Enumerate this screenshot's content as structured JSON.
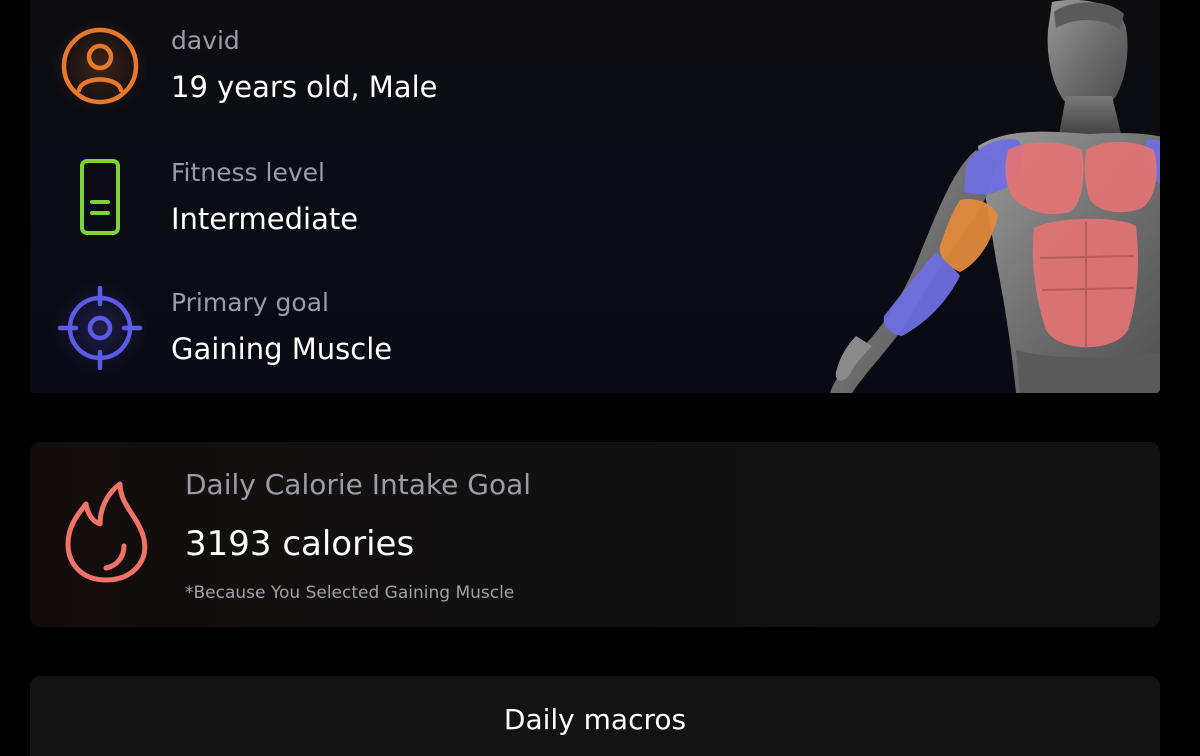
{
  "profile": {
    "user": {
      "name": "david",
      "details": "19 years old, Male",
      "icon": "user-icon",
      "color": "#E8792A"
    },
    "fitness": {
      "label": "Fitness level",
      "value": "Intermediate",
      "icon": "clipboard-icon",
      "color": "#7ED33A"
    },
    "goal": {
      "label": "Primary goal",
      "value": "Gaining Muscle",
      "icon": "target-icon",
      "color": "#5B5BE6"
    },
    "figure": {
      "icon": "muscle-body-figure",
      "highlight_colors": {
        "chest_abs": "#E57373",
        "shoulders_biceps": "#6F6FE0",
        "forearms": "#E08A3C"
      }
    }
  },
  "calorie": {
    "label": "Daily Calorie Intake Goal",
    "value": "3193 calories",
    "note": "*Because You Selected Gaining Muscle",
    "icon": "flame-icon",
    "color": "#F07368"
  },
  "macros": {
    "title": "Daily macros"
  }
}
